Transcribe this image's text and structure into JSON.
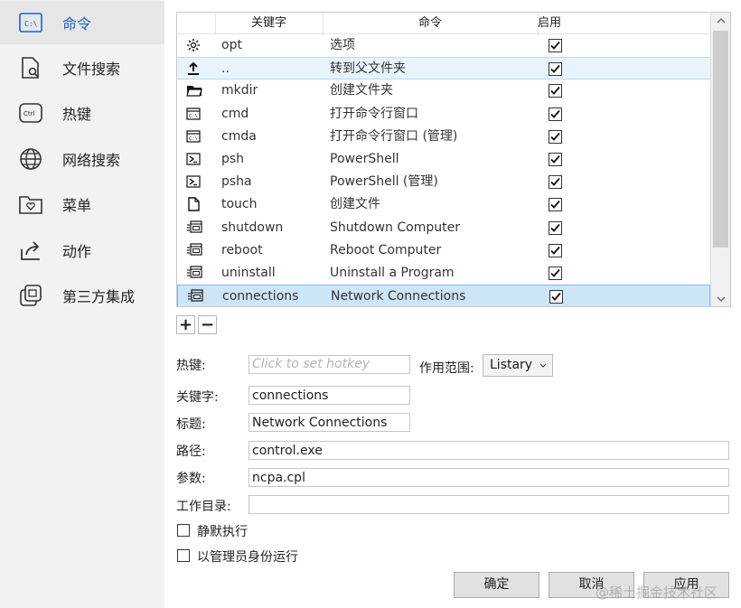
{
  "sidebar": {
    "items": [
      {
        "label": "命令",
        "icon": "cmd-icon",
        "active": true
      },
      {
        "label": "文件搜索",
        "icon": "file-search-icon"
      },
      {
        "label": "热键",
        "icon": "ctrl-key-icon"
      },
      {
        "label": "网络搜索",
        "icon": "globe-icon"
      },
      {
        "label": "菜单",
        "icon": "menu-folder-icon"
      },
      {
        "label": "动作",
        "icon": "share-action-icon"
      },
      {
        "label": "第三方集成",
        "icon": "integration-icon"
      }
    ]
  },
  "table": {
    "headers": {
      "keyword": "关键字",
      "command": "命令",
      "enabled": "启用"
    },
    "rows": [
      {
        "icon": "gear-icon",
        "keyword": "opt",
        "command": "选项",
        "enabled": true
      },
      {
        "icon": "upload-arrow-icon",
        "keyword": "..",
        "command": "转到父文件夹",
        "enabled": true
      },
      {
        "icon": "folder-icon",
        "keyword": "mkdir",
        "command": "创建文件夹",
        "enabled": true
      },
      {
        "icon": "console-icon",
        "keyword": "cmd",
        "command": "打开命令行窗口",
        "enabled": true
      },
      {
        "icon": "console-icon",
        "keyword": "cmda",
        "command": "打开命令行窗口 (管理)",
        "enabled": true
      },
      {
        "icon": "powershell-icon",
        "keyword": "psh",
        "command": "PowerShell",
        "enabled": true
      },
      {
        "icon": "powershell-icon",
        "keyword": "psha",
        "command": "PowerShell (管理)",
        "enabled": true
      },
      {
        "icon": "file-icon",
        "keyword": "touch",
        "command": "创建文件",
        "enabled": true
      },
      {
        "icon": "system-icon",
        "keyword": "shutdown",
        "command": "Shutdown Computer",
        "enabled": true
      },
      {
        "icon": "system-icon",
        "keyword": "reboot",
        "command": "Reboot Computer",
        "enabled": true
      },
      {
        "icon": "system-icon",
        "keyword": "uninstall",
        "command": "Uninstall a Program",
        "enabled": true
      },
      {
        "icon": "system-icon",
        "keyword": "connections",
        "command": "Network Connections",
        "enabled": true
      }
    ]
  },
  "toolbar": {
    "add_label": "+",
    "remove_label": "−"
  },
  "form": {
    "hotkey_label": "热键:",
    "hotkey_placeholder": "Click to set hotkey",
    "scope_label": "作用范围:",
    "scope_value": "Listary",
    "keyword_label": "关键字:",
    "keyword_value": "connections",
    "title_label": "标题:",
    "title_value": "Network Connections",
    "path_label": "路径:",
    "path_value": "control.exe",
    "args_label": "参数:",
    "args_value": "ncpa.cpl",
    "workdir_label": "工作目录:",
    "workdir_value": "",
    "silent_label": "静默执行",
    "admin_label": "以管理员身份运行"
  },
  "buttons": {
    "ok": "确定",
    "cancel": "取消",
    "apply": "应用"
  },
  "watermark": "@稀土掘金技术社区",
  "colors": {
    "accent": "#1c64c6",
    "selected_row": "#cce6f8"
  }
}
